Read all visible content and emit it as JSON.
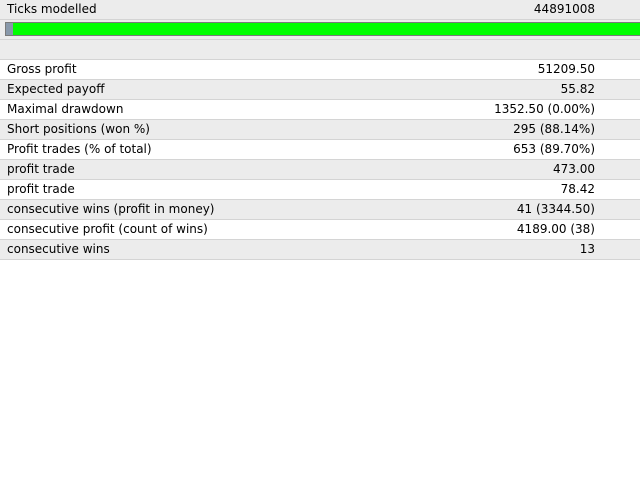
{
  "ticks": {
    "label": "Ticks modelled",
    "value": "44891008"
  },
  "progress": {
    "fraction": 1.0,
    "fill_color": "#00ff00"
  },
  "stats": [
    {
      "label": "Gross profit",
      "value": "51209.50"
    },
    {
      "label": "Expected payoff",
      "value": "55.82"
    },
    {
      "label": "Maximal drawdown",
      "value": "1352.50 (0.00%)"
    },
    {
      "label": "Short positions (won %)",
      "value": "295 (88.14%)"
    },
    {
      "label": "Profit trades (% of total)",
      "value": "653 (89.70%)"
    },
    {
      "label": "profit trade",
      "value": "473.00"
    },
    {
      "label": "profit trade",
      "value": "78.42"
    },
    {
      "label": "consecutive wins (profit in money)",
      "value": "41 (3344.50)"
    },
    {
      "label": "consecutive profit (count of wins)",
      "value": "4189.00 (38)"
    },
    {
      "label": "consecutive wins",
      "value": "13"
    }
  ]
}
